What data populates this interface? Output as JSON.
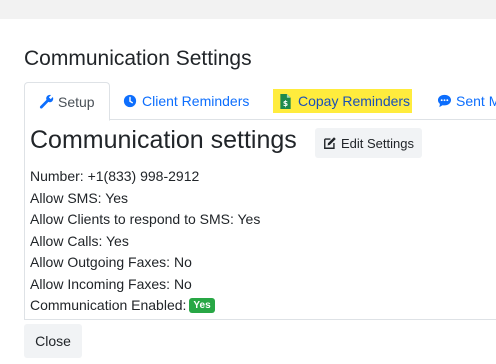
{
  "modal": {
    "title": "Communication Settings"
  },
  "tabs": [
    {
      "label": "Setup",
      "icon": "wrench-icon"
    },
    {
      "label": "Client Reminders",
      "icon": "clock-icon"
    },
    {
      "label": "Copay Reminders",
      "icon": "document-dollar-icon"
    },
    {
      "label": "Sent M",
      "icon": "comment-icon"
    }
  ],
  "panel": {
    "heading": "Communication settings",
    "edit_label": "Edit Settings",
    "rows": {
      "number": "Number: +1(833) 998-2912",
      "allow_sms": "Allow SMS: Yes",
      "clients_respond": "Allow Clients to respond to SMS: Yes",
      "allow_calls": "Allow Calls: Yes",
      "outgoing_faxes": "Allow Outgoing Faxes: No",
      "incoming_faxes": "Allow Incoming Faxes: No",
      "enabled_label": "Communication Enabled:",
      "enabled_badge": "Yes"
    }
  },
  "footer": {
    "close_label": "Close"
  },
  "colors": {
    "link": "#0d6efd",
    "highlight": "#ffec3d",
    "badge": "#28a745"
  }
}
